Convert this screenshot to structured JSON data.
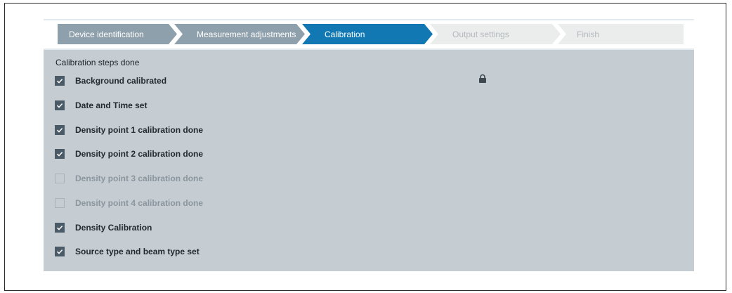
{
  "wizard": {
    "steps": [
      {
        "label": "Device identification",
        "state": "done"
      },
      {
        "label": "Measurement adjustments",
        "state": "done"
      },
      {
        "label": "Calibration",
        "state": "active"
      },
      {
        "label": "Output settings",
        "state": "todo"
      },
      {
        "label": "Finish",
        "state": "todo"
      }
    ],
    "colors": {
      "done": "#8fa0ad",
      "active": "#1278b4",
      "todo": "#ebeded"
    }
  },
  "panel": {
    "title": "Calibration steps done",
    "lock_icon": "lock-icon",
    "checkbox_icon": "checkmark-icon",
    "items": [
      {
        "label": "Background calibrated",
        "checked": true
      },
      {
        "label": "Date and Time set",
        "checked": true
      },
      {
        "label": "Density point 1 calibration done",
        "checked": true
      },
      {
        "label": "Density point 2 calibration done",
        "checked": true
      },
      {
        "label": "Density point 3 calibration done",
        "checked": false
      },
      {
        "label": "Density point 4 calibration done",
        "checked": false
      },
      {
        "label": "Density Calibration",
        "checked": true
      },
      {
        "label": "Source type and beam type set",
        "checked": true
      }
    ],
    "colors": {
      "background": "#c5cdd3",
      "checkbox_on": "#4b5a67"
    }
  }
}
